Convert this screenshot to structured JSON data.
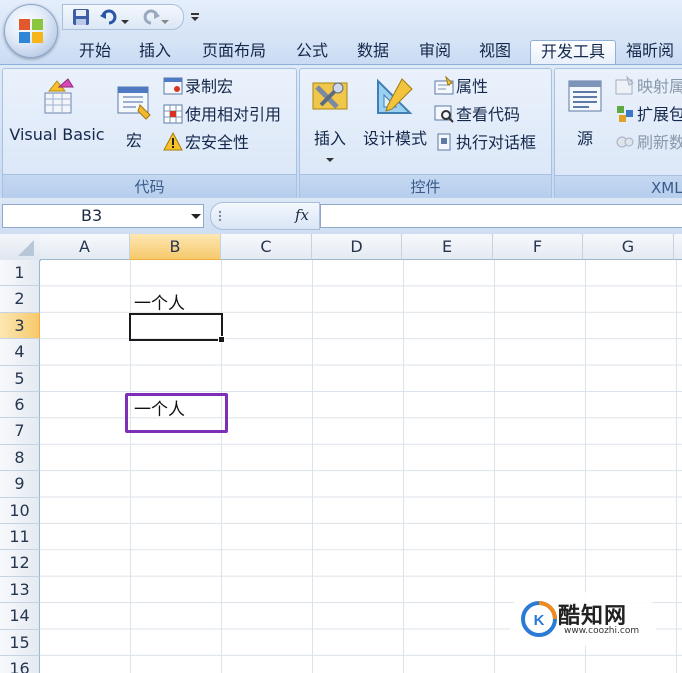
{
  "ribbon": {
    "tabs": [
      "开始",
      "插入",
      "页面布局",
      "公式",
      "数据",
      "审阅",
      "视图",
      "开发工具",
      "福昕阅"
    ],
    "active_tab": "开发工具",
    "groups": {
      "code": {
        "label": "代码",
        "visual_basic": "Visual Basic",
        "macros": "宏",
        "record_macro": "录制宏",
        "use_relative": "使用相对引用",
        "macro_security": "宏安全性"
      },
      "controls": {
        "label": "控件",
        "insert": "插入",
        "design_mode": "设计模式",
        "properties": "属性",
        "view_code": "查看代码",
        "run_dialog": "执行对话框"
      },
      "xml": {
        "label": "XML",
        "source": "源",
        "map_properties": "映射属",
        "expansion_packs": "扩展包",
        "refresh_data": "刷新数"
      }
    }
  },
  "formula_bar": {
    "name_box": "B3",
    "fx": "fx",
    "formula": ""
  },
  "sheet": {
    "columns": [
      "A",
      "B",
      "C",
      "D",
      "E",
      "F",
      "G"
    ],
    "selected_column": "B",
    "rows": [
      "1",
      "2",
      "3",
      "4",
      "5",
      "6",
      "7",
      "8",
      "9",
      "10",
      "11",
      "12",
      "13",
      "14",
      "15",
      "16"
    ],
    "selected_row": "3",
    "cells": {
      "B2": "一个人",
      "B6": "一个人"
    }
  },
  "watermark": {
    "name": "酷知网",
    "url": "www.coozhi.com"
  },
  "colors": {
    "highlight_box": "#7d2fb8",
    "selected_header": "#f6c96b"
  }
}
